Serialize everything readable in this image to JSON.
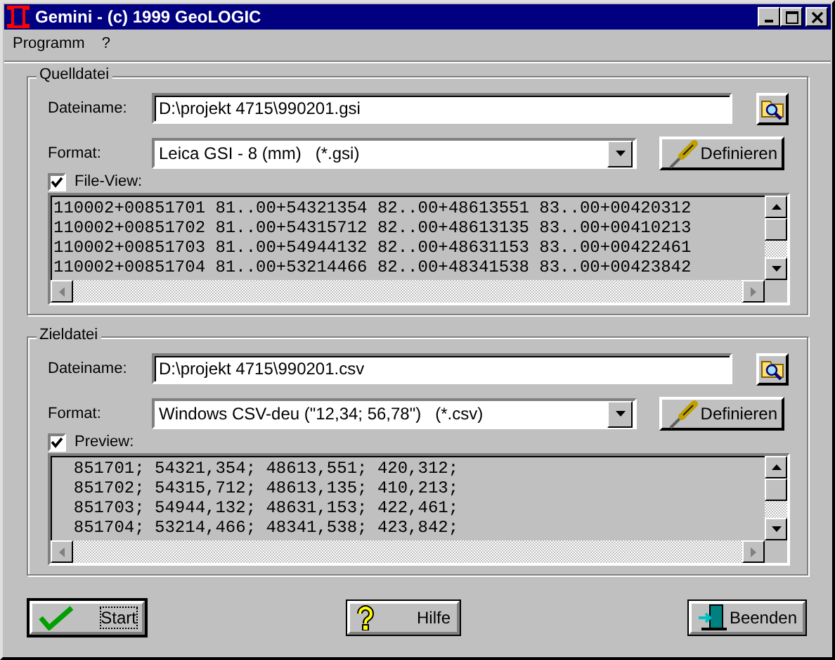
{
  "window": {
    "title": "Gemini - (c) 1999 GeoLOGIC"
  },
  "menu": [
    "Programm",
    "?"
  ],
  "groups": [
    {
      "title": "Quelldatei",
      "filename_label": "Dateiname:",
      "filename": "D:\\projekt 4715\\990201.gsi",
      "format_label": "Format:",
      "format": "Leica GSI - 8 (mm)   (*.gsi)",
      "define_button": "Definieren",
      "view": {
        "label": "File-View:",
        "checked": true,
        "lines": [
          "110002+00851701 81..00+54321354 82..00+48613551 83..00+00420312",
          "110002+00851702 81..00+54315712 82..00+48613135 83..00+00410213",
          "110002+00851703 81..00+54944132 82..00+48631153 83..00+00422461",
          "110002+00851704 81..00+53214466 82..00+48341538 83..00+00423842"
        ]
      }
    },
    {
      "title": "Zieldatei",
      "filename_label": "Dateiname:",
      "filename": "D:\\projekt 4715\\990201.csv",
      "format_label": "Format:",
      "format": "Windows CSV-deu (\"12,34; 56,78\")   (*.csv)",
      "define_button": "Definieren",
      "view": {
        "label": "Preview:",
        "checked": true,
        "lines": [
          "  851701; 54321,354; 48613,551; 420,312;",
          "  851702; 54315,712; 48613,135; 410,213;",
          "  851703; 54944,132; 48631,153; 422,461;",
          "  851704; 53214,466; 48341,538; 423,842;"
        ]
      }
    }
  ],
  "buttons": [
    {
      "kind": "start",
      "label": "Start",
      "focused": true
    },
    {
      "kind": "help",
      "label": "Hilfe",
      "focused": false
    },
    {
      "kind": "exit",
      "label": "Beenden",
      "focused": false
    }
  ]
}
